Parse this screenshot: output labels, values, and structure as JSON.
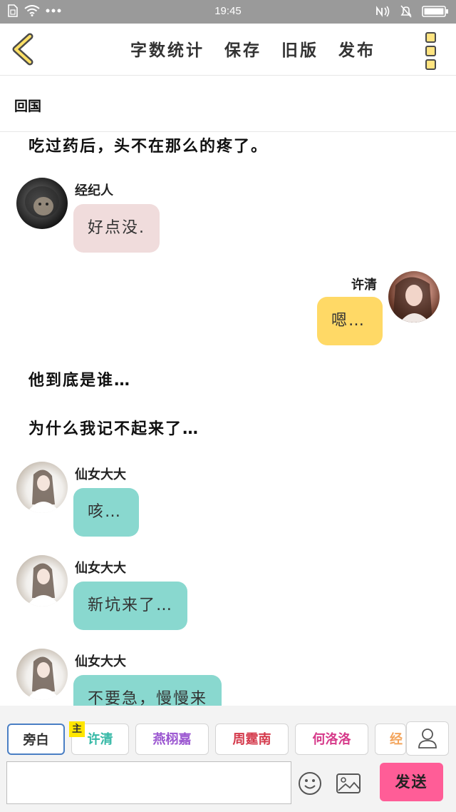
{
  "status_bar": {
    "time": "19:45"
  },
  "nav": {
    "word_count": "字数统计",
    "save": "保存",
    "old_version": "旧版",
    "publish": "发布"
  },
  "chapter": {
    "title": "回国"
  },
  "messages": {
    "narration_1": "吃过药后，头不在那么的疼了。",
    "agent_name": "经纪人",
    "agent_text": "好点没.",
    "xuqing_name": "许清",
    "xuqing_text": "嗯…",
    "narration_2": "他到底是谁…",
    "narration_3": "为什么我记不起来了…",
    "fairy_1_name": "仙女大大",
    "fairy_1_text": "咳…",
    "fairy_2_name": "仙女大大",
    "fairy_2_text": "新坑来了…",
    "fairy_3_name": "仙女大大",
    "fairy_3_text": "不要急，慢慢来"
  },
  "characters": {
    "narrator": "旁白",
    "main_tag": "主",
    "xuqing": "许清",
    "char_3": "燕栩嘉",
    "char_4": "周霆南",
    "char_5": "何洛洛",
    "char_6": "经"
  },
  "composer": {
    "input_value": "",
    "send": "发送"
  },
  "colors": {
    "char_xuqing": "#35b8a6",
    "char_3": "#9a55d0",
    "char_4": "#d4394b",
    "char_5": "#d63a8a",
    "char_6": "#f3a45b",
    "send_button": "#ff5d97",
    "bubble_pink": "#f0dcdc",
    "bubble_yellow": "#ffd966",
    "bubble_teal": "#89d8cf"
  }
}
